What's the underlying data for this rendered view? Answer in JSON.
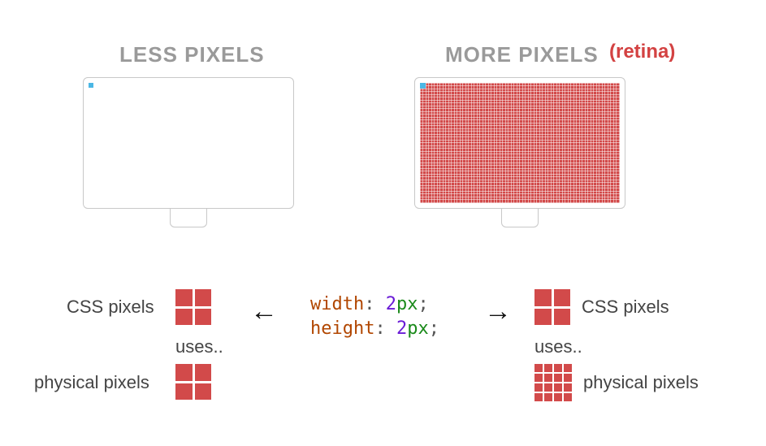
{
  "headings": {
    "left": "LESS PIXELS",
    "right": "MORE PIXELS",
    "retina": "(retina)"
  },
  "code": {
    "width_prop": "width",
    "height_prop": "height",
    "value_num": "2",
    "value_unit": "px"
  },
  "labels": {
    "css_pixels": "CSS pixels",
    "uses": "uses..",
    "physical_pixels": "physical pixels"
  },
  "arrows": {
    "left": "←",
    "right": "→"
  },
  "diagram": {
    "left_screen_grid": "standard-density pixel grid",
    "right_screen_grid": "retina-density pixel grid",
    "css_block": "2x2 css pixel block",
    "physical_block_1x": "2x2 physical pixel block",
    "physical_block_2x": "4x4 physical pixel block"
  }
}
